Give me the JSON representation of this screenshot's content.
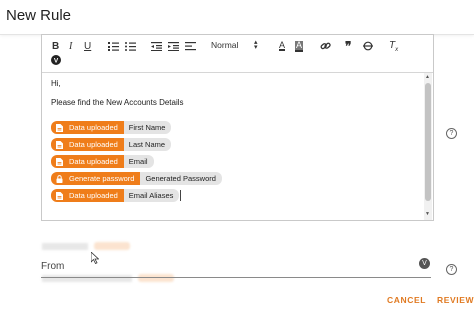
{
  "header": {
    "title": "New Rule"
  },
  "toolbar": {
    "format_value": "Normal",
    "buttons": [
      "bold",
      "italic",
      "underline",
      "ordered-list",
      "bullet-list",
      "outdent",
      "indent",
      "align",
      "font-color",
      "highlight",
      "link",
      "blockquote",
      "strikethrough",
      "clear-format",
      "variable"
    ]
  },
  "editor": {
    "greeting": "Hi,",
    "intro": "Please find the New Accounts Details",
    "chips": [
      {
        "tag": "Data uploaded",
        "field": "First Name",
        "icon": "file-icon"
      },
      {
        "tag": "Data uploaded",
        "field": "Last Name",
        "icon": "file-icon"
      },
      {
        "tag": "Data uploaded",
        "field": "Email",
        "icon": "file-icon"
      },
      {
        "tag": "Generate password",
        "field": "Generated Password",
        "icon": "lock-icon"
      },
      {
        "tag": "Data uploaded",
        "field": "Email Aliases",
        "icon": "file-icon"
      }
    ]
  },
  "from": {
    "label": "From"
  },
  "footer": {
    "cancel": "CANCEL",
    "review": "REVIEW"
  },
  "colors": {
    "accent": "#ef7d1a",
    "chip_bg": "#e4e4e4",
    "action": "#e07a22"
  }
}
